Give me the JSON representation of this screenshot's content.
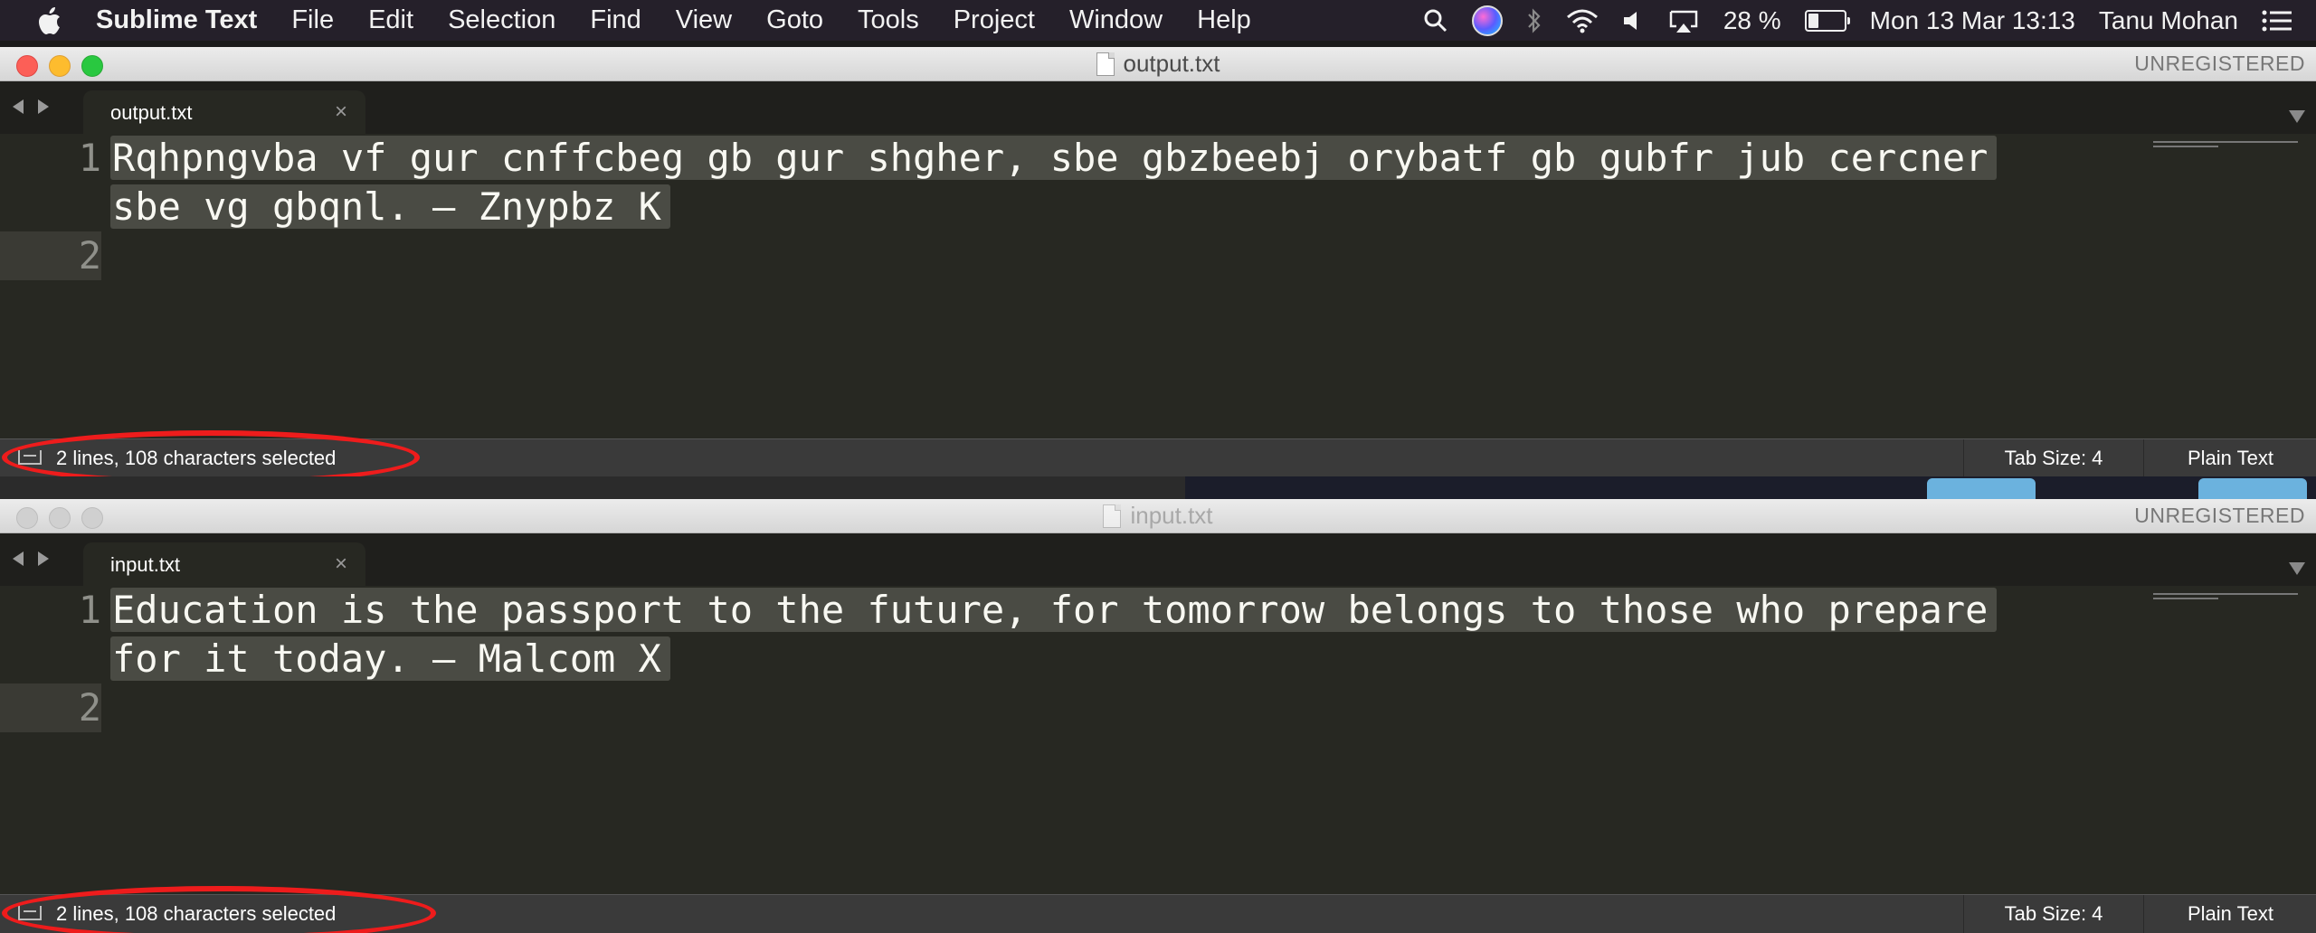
{
  "menubar": {
    "app_name": "Sublime Text",
    "items": [
      "File",
      "Edit",
      "Selection",
      "Find",
      "View",
      "Goto",
      "Tools",
      "Project",
      "Window",
      "Help"
    ],
    "battery_percent": "28 %",
    "clock": "Mon 13 Mar  13:13",
    "user": "Tanu Mohan"
  },
  "windows": [
    {
      "title": "output.txt",
      "unregistered": "UNREGISTERED",
      "tab_label": "output.txt",
      "tab_close": "×",
      "line_numbers": [
        "1",
        "2"
      ],
      "lines": [
        "Rqhpngvba vf gur cnffcbeg gb gur shgher, sbe gbzbeebj orybatf gb gubfr jub cercner",
        "sbe vg gbqnl. – Znypbz K"
      ],
      "status": "2 lines, 108 characters selected",
      "tab_size": "Tab Size: 4",
      "syntax": "Plain Text"
    },
    {
      "title": "input.txt",
      "unregistered": "UNREGISTERED",
      "tab_label": "input.txt",
      "tab_close": "×",
      "line_numbers": [
        "1",
        "2"
      ],
      "lines": [
        "Education is the passport to the future, for tomorrow belongs to those who prepare",
        "for it today. – Malcom X"
      ],
      "status": "2 lines, 108 characters selected",
      "tab_size": "Tab Size: 4",
      "syntax": "Plain Text"
    }
  ],
  "colors": {
    "editor_bg": "#272822",
    "selection": "#4a4b44",
    "highlight_annotation": "#ee1c1c"
  }
}
